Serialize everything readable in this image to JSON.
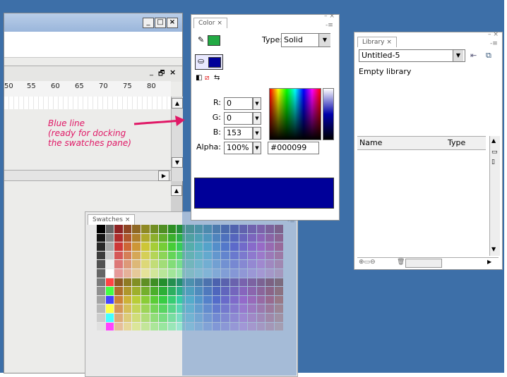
{
  "annotation": {
    "text": "Blue line\n(ready for docking\nthe swatches pane)"
  },
  "main_window": {
    "title_buttons": [
      "_",
      "□",
      "×"
    ],
    "timeline_controls": [
      "_",
      "🗗",
      "×"
    ],
    "ruler_numbers": [
      "50",
      "55",
      "60",
      "65",
      "70",
      "75",
      "80"
    ]
  },
  "color_panel": {
    "tab_label": "Color ×",
    "type_label": "Type:",
    "type_value": "Solid",
    "r_label": "R:",
    "r_value": "0",
    "g_label": "G:",
    "g_value": "0",
    "b_label": "B:",
    "b_value": "153",
    "alpha_label": "Alpha:",
    "alpha_value": "100%",
    "hex_value": "#000099",
    "fill_color": "#000099",
    "stroke_color": "#22aa44"
  },
  "library_panel": {
    "tab_label": "Library ×",
    "document": "Untitled-5",
    "empty_text": "Empty library",
    "col_name": "Name",
    "col_type": "Type"
  },
  "swatches_panel": {
    "tab_label": "Swatches ×"
  }
}
